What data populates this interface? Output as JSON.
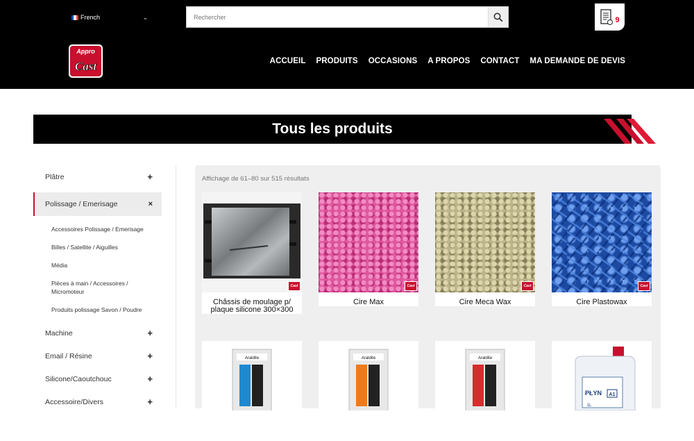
{
  "header": {
    "language": "French",
    "search_placeholder": "Rechercher",
    "cart_count": "9",
    "logo_top": "Appro",
    "logo_bottom": "Cast",
    "nav": [
      "ACCUEIL",
      "PRODUITS",
      "OCCASIONS",
      "A PROPOS",
      "CONTACT",
      "MA DEMANDE DE DEVIS"
    ]
  },
  "page": {
    "title": "Tous les produits"
  },
  "sidebar": {
    "categories": [
      {
        "label": "Plâtre",
        "toggle": "+"
      },
      {
        "label": "Polissage / Emerisage",
        "toggle": "×",
        "active": true,
        "children": [
          "Accessoires Polissage / Emerisage",
          "Billes / Satellite / Aiguilles",
          "Média",
          "Pièces à main / Accessoires / Micromoteur",
          "Produits polissage Savon / Poudre"
        ]
      },
      {
        "label": "Machine",
        "toggle": "+"
      },
      {
        "label": "Email / Résine",
        "toggle": "+"
      },
      {
        "label": "Silicone/Caoutchouc",
        "toggle": "+"
      },
      {
        "label": "Accessoire/Divers",
        "toggle": "+"
      }
    ]
  },
  "products": {
    "results_text": "Affichage de 61–80 sur 515 résultats",
    "badge_text": "Cast",
    "items": [
      {
        "name": "Châssis de moulage p/ plaque silicone 300×300"
      },
      {
        "name": "Cire Max"
      },
      {
        "name": "Cire Meca Wax"
      },
      {
        "name": "Cire Plastowax"
      },
      {
        "name": ""
      },
      {
        "name": ""
      },
      {
        "name": ""
      },
      {
        "name": ""
      }
    ],
    "row2_labels": [
      "Araldite",
      "Araldite",
      "Araldite",
      "PŁYN",
      "A1",
      "1L"
    ]
  },
  "colors": {
    "accent": "#c8102e",
    "header_bg": "#000000",
    "panel_bg": "#efefef"
  }
}
